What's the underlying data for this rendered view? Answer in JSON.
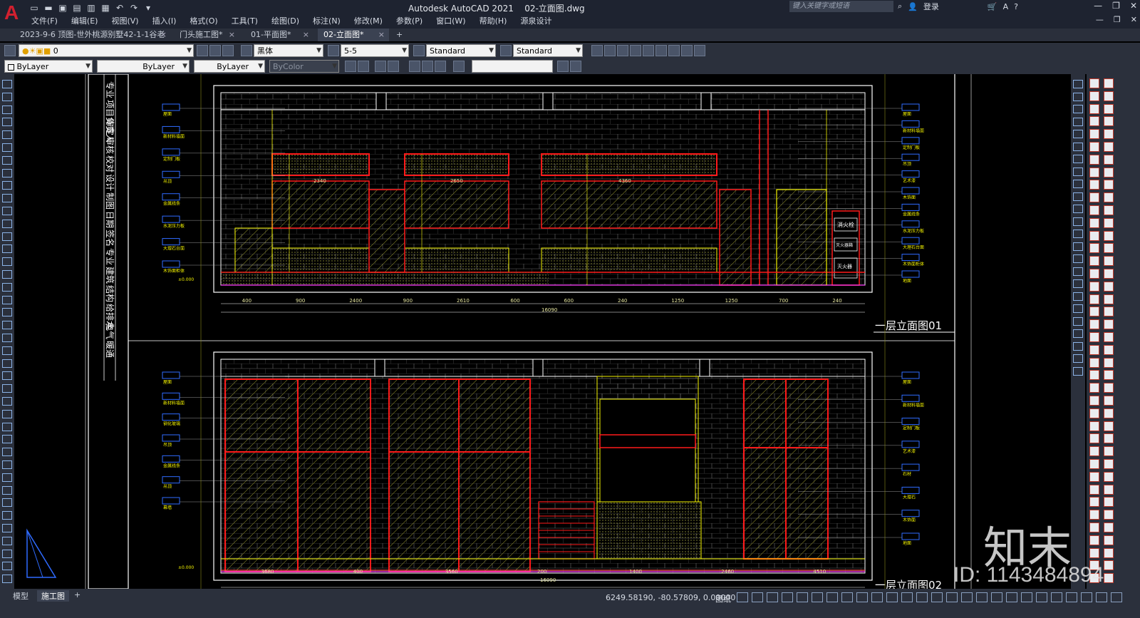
{
  "app": {
    "title": "Autodesk AutoCAD 2021",
    "document": "02-立面图.dwg",
    "logo": "A",
    "search_placeholder": "键入关键字或短语",
    "login": "登录"
  },
  "menu": [
    "文件(F)",
    "编辑(E)",
    "视图(V)",
    "插入(I)",
    "格式(O)",
    "工具(T)",
    "绘图(D)",
    "标注(N)",
    "修改(M)",
    "参数(P)",
    "窗口(W)",
    "帮助(H)",
    "源泉设计"
  ],
  "tabs": [
    {
      "label": "2023-9-6 顶图-世外桃源别墅42-1-1谷老师*",
      "active": false
    },
    {
      "label": "门头施工图*",
      "active": false
    },
    {
      "label": "01-平面图*",
      "active": false
    },
    {
      "label": "02-立面图*",
      "active": true
    }
  ],
  "toolbar1": {
    "layer": "0",
    "text_style_font": "黑体",
    "dim_style": "5-5",
    "table_style": "Standard",
    "multileader_style": "Standard"
  },
  "toolbar2": {
    "color": "ByLayer",
    "linetype": "ByLayer",
    "lineweight": "ByLayer",
    "plot_style": "ByColor"
  },
  "drawing": {
    "title_top": "一层立面图01",
    "title_bottom": "一层立面图02",
    "top_dims": [
      "400",
      "900",
      "2400",
      "900",
      "2610",
      "600",
      "600",
      "240",
      "1250",
      "1250",
      "700",
      "240"
    ],
    "top_total": "16090",
    "bottom_dims": [
      "3680",
      "400",
      "3560",
      "200",
      "1400",
      "2460",
      "4510"
    ],
    "bottom_total": "16090",
    "inner_dims": [
      "2340",
      "2650",
      "4360"
    ],
    "labels_top_left": [
      "屋面",
      "新材料墙面",
      "定制门板",
      "吊顶",
      "金属线条",
      "水泥压力板",
      "大理石台面",
      "木饰面柜体"
    ],
    "labels_top_right": [
      "屋面",
      "新材料墙面",
      "定制门板",
      "吊顶",
      "艺术漆",
      "木饰面",
      "金属线条",
      "水泥压力板",
      "大理石台面",
      "木饰面柜体",
      "地面"
    ],
    "labels_bottom_left": [
      "屋面",
      "新材料墙面",
      "钢化玻璃",
      "吊顶",
      "金属线条",
      "吊顶",
      "幕墙"
    ],
    "labels_bottom_right": [
      "屋面",
      "新材料墙面",
      "定制门板",
      "艺术漆",
      "石材",
      "大理石",
      "木饰面",
      "地面"
    ],
    "panel_texts": [
      "消火栓",
      "灭火器箱",
      "灭火器"
    ],
    "level_marks": [
      "±0.000",
      "±0.000"
    ],
    "title_block": [
      "专业",
      "项目负责人",
      "审定",
      "审核",
      "校对",
      "设计",
      "制图",
      "日期",
      "签名",
      "专业",
      "建筑",
      "结构",
      "给排水",
      "电气",
      "暖通"
    ]
  },
  "status": {
    "model_tab": "模型",
    "layout_tab": "施工图",
    "coords": "6249.58190, -80.57809, 0.00000",
    "mode": "图纸"
  },
  "watermark": {
    "brand": "知末",
    "id": "ID: 1143484894"
  },
  "colors": {
    "chrome": "#2b303c",
    "titlebar": "#1e2330",
    "canvas": "#000000",
    "cad_red": "#ff1a1a",
    "cad_yellow": "#f4f400",
    "cad_white": "#ffffff",
    "cad_blue": "#2f6bff",
    "cad_green": "#3fd63f",
    "cad_magenta": "#ff3cff"
  }
}
